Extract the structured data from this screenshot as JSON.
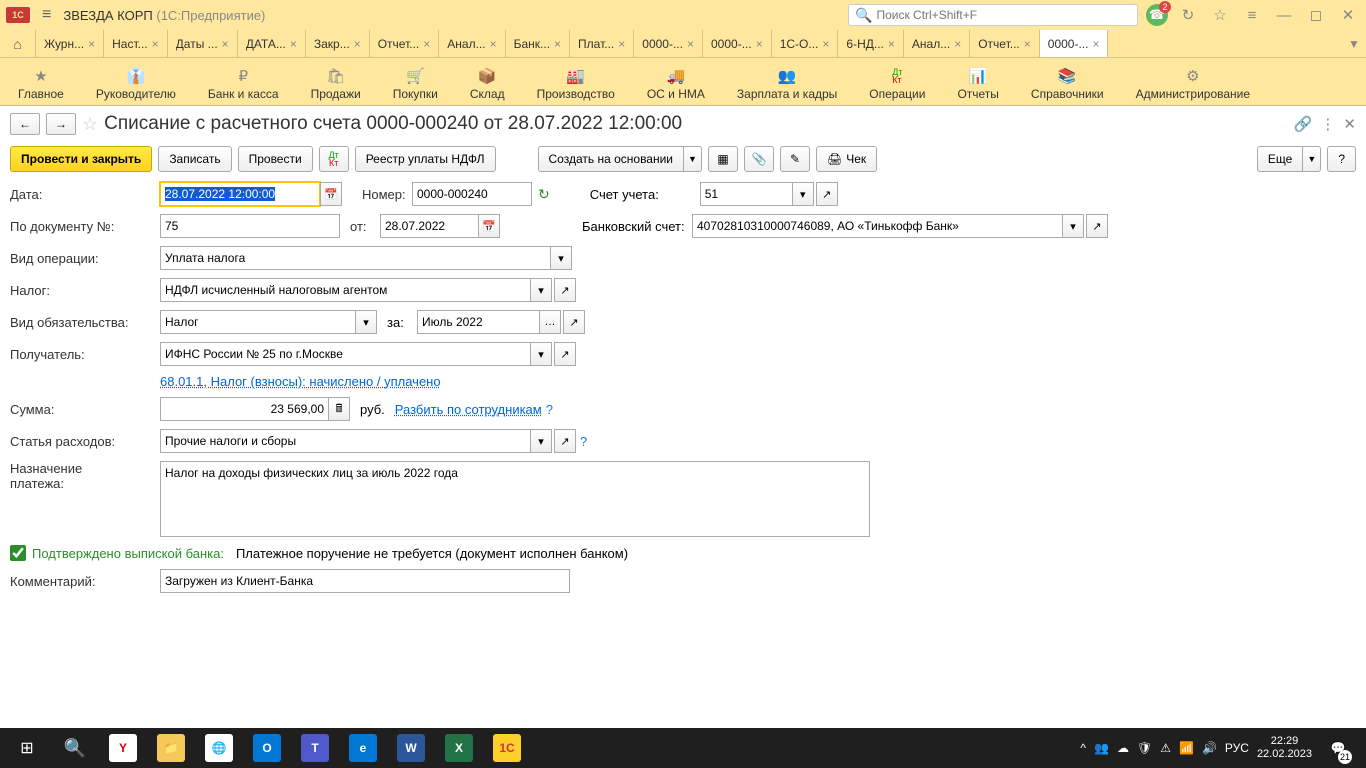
{
  "titlebar": {
    "app_name": "ЗВЕЗДА КОРП",
    "platform": "(1С:Предприятие)",
    "search_placeholder": "Поиск Ctrl+Shift+F",
    "bell_count": "2"
  },
  "tabs": [
    {
      "label": "Журн..."
    },
    {
      "label": "Наст..."
    },
    {
      "label": "Даты ..."
    },
    {
      "label": "ДАТА..."
    },
    {
      "label": "Закр..."
    },
    {
      "label": "Отчет..."
    },
    {
      "label": "Анал..."
    },
    {
      "label": "Банк..."
    },
    {
      "label": "Плат..."
    },
    {
      "label": "0000-..."
    },
    {
      "label": "0000-..."
    },
    {
      "label": "1С-О..."
    },
    {
      "label": "6-НД..."
    },
    {
      "label": "Анал..."
    },
    {
      "label": "Отчет..."
    },
    {
      "label": "0000-..."
    }
  ],
  "nav": [
    {
      "icon": "★",
      "label": "Главное"
    },
    {
      "icon": "👔",
      "label": "Руководителю"
    },
    {
      "icon": "₽",
      "label": "Банк и касса"
    },
    {
      "icon": "🛍",
      "label": "Продажи"
    },
    {
      "icon": "🛒",
      "label": "Покупки"
    },
    {
      "icon": "📦",
      "label": "Склад"
    },
    {
      "icon": "🏭",
      "label": "Производство"
    },
    {
      "icon": "🚚",
      "label": "ОС и НМА"
    },
    {
      "icon": "👥",
      "label": "Зарплата и кадры"
    },
    {
      "icon": "ДК",
      "label": "Операции"
    },
    {
      "icon": "📊",
      "label": "Отчеты"
    },
    {
      "icon": "📚",
      "label": "Справочники"
    },
    {
      "icon": "⚙",
      "label": "Администрирование"
    }
  ],
  "doc": {
    "title": "Списание с расчетного счета 0000-000240 от 28.07.2022 12:00:00"
  },
  "toolbar": {
    "save_close": "Провести и закрыть",
    "write": "Записать",
    "post": "Провести",
    "ndfl_registry": "Реестр уплаты НДФЛ",
    "create_based": "Создать на основании",
    "check": "Чек",
    "more": "Еще",
    "help": "?"
  },
  "form": {
    "date_label": "Дата:",
    "date_value": "28.07.2022 12:00:00",
    "number_label": "Номер:",
    "number_value": "0000-000240",
    "account_label": "Счет учета:",
    "account_value": "51",
    "docnum_label": "По документу №:",
    "docnum_value": "75",
    "ot_label": "от:",
    "ot_value": "28.07.2022",
    "bank_account_label": "Банковский счет:",
    "bank_account_value": "40702810310000746089, АО «Тинькофф Банк»",
    "optype_label": "Вид операции:",
    "optype_value": "Уплата налога",
    "tax_label": "Налог:",
    "tax_value": "НДФЛ исчисленный налоговым агентом",
    "obligation_label": "Вид обязательства:",
    "obligation_value": "Налог",
    "za_label": "за:",
    "za_value": "Июль 2022",
    "recipient_label": "Получатель:",
    "recipient_value": "ИФНС России № 25 по г.Москве",
    "account_link": "68.01.1, Налог (взносы): начислено / уплачено",
    "amount_label": "Сумма:",
    "amount_value": "23 569,00",
    "amount_cur": "руб.",
    "split_link": "Разбить по сотрудникам",
    "expense_label": "Статья расходов:",
    "expense_value": "Прочие налоги и сборы",
    "purpose_label1": "Назначение",
    "purpose_label2": "платежа:",
    "purpose_value": "Налог на доходы физических лиц за июль 2022 года",
    "confirmed_label": "Подтверждено выпиской банка:",
    "confirmed_note": "Платежное поручение не требуется (документ исполнен банком)",
    "comment_label": "Комментарий:",
    "comment_value": "Загружен из Клиент-Банка"
  },
  "taskbar": {
    "time": "22:29",
    "date": "22.02.2023",
    "lang": "РУС",
    "notif_count": "21"
  }
}
